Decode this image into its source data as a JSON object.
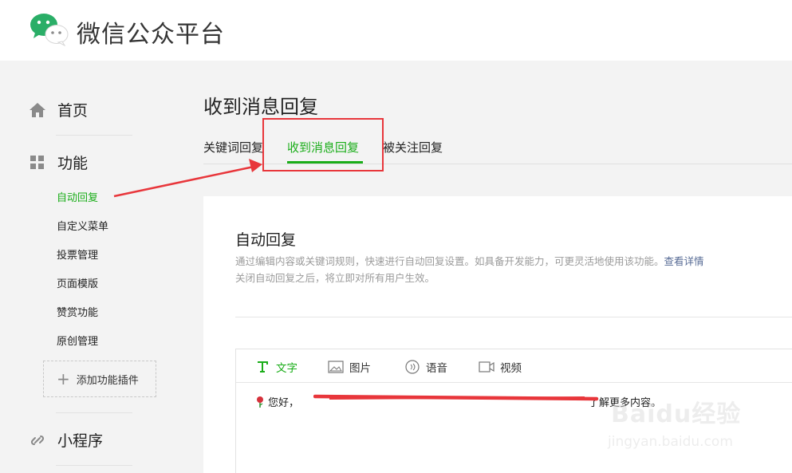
{
  "app": {
    "brand": "微信公众平台",
    "logo_icon": "wechat-logo-icon",
    "accent": "#1aad19",
    "annotation_color": "#e8363b"
  },
  "sidebar": {
    "home": {
      "label": "首页",
      "icon": "home-icon"
    },
    "features": {
      "label": "功能",
      "icon": "grid-icon"
    },
    "feature_items": [
      {
        "label": "自动回复",
        "active": true
      },
      {
        "label": "自定义菜单"
      },
      {
        "label": "投票管理"
      },
      {
        "label": "页面模版"
      },
      {
        "label": "赞赏功能"
      },
      {
        "label": "原创管理"
      }
    ],
    "add_plugin": "添加功能插件",
    "mini_program": {
      "label": "小程序",
      "icon": "link-icon"
    }
  },
  "main": {
    "title": "收到消息回复",
    "tabs": [
      {
        "label": "关键词回复"
      },
      {
        "label": "收到消息回复",
        "active": true
      },
      {
        "label": "被关注回复"
      }
    ]
  },
  "card": {
    "title": "自动回复",
    "desc_line1": "通过编辑内容或关键词规则，快速进行自动回复设置。如具备开发能力，可更灵活地使用该功能。",
    "desc_link": "查看详情",
    "desc_line2": "关闭自动回复之后，将立即对所有用户生效。"
  },
  "editor": {
    "tools": [
      {
        "label": "文字",
        "icon": "text-icon",
        "active": true
      },
      {
        "label": "图片",
        "icon": "image-icon"
      },
      {
        "label": "语音",
        "icon": "voice-icon"
      },
      {
        "label": "视频",
        "icon": "video-icon"
      }
    ],
    "message_start": "您好，",
    "message_end": "了解更多内容。"
  },
  "watermark": {
    "main": "Baidu经验",
    "sub": "jingyan.baidu.com"
  }
}
